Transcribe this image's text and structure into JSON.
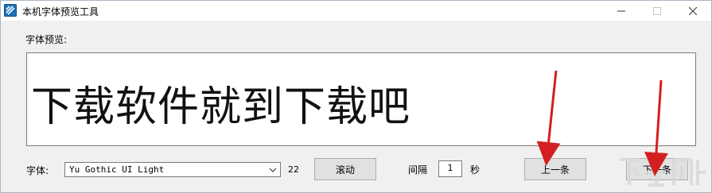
{
  "window": {
    "title": "本机字体预览工具"
  },
  "preview": {
    "label": "字体预览:",
    "sample_text": "下载软件就到下载吧"
  },
  "controls": {
    "font_label": "字体:",
    "font_value": "Yu Gothic UI Light",
    "font_size": "22",
    "scroll_button": "滚动",
    "interval_label": "间隔",
    "interval_value": "1",
    "interval_unit": "秒",
    "prev_button": "上一条",
    "next_button": "下一条"
  },
  "colors": {
    "annotation_arrow": "#d31f1f",
    "window_bg": "#f0f0f0",
    "button_bg": "#e1e1e1"
  },
  "icons": {
    "app": "app-icon",
    "minimize": "minimize-icon",
    "maximize": "maximize-icon",
    "close": "close-icon",
    "dropdown": "chevron-down-icon"
  }
}
